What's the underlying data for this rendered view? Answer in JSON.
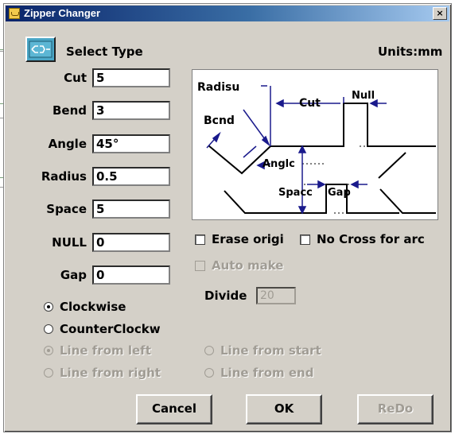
{
  "window": {
    "title": "Zipper Changer",
    "close_label": "×"
  },
  "header": {
    "select_type_label": "Select Type",
    "units_label": "Units:mm"
  },
  "params": [
    {
      "label": "Cut",
      "value": "5"
    },
    {
      "label": "Bend",
      "value": "3"
    },
    {
      "label": "Angle",
      "value": "45°"
    },
    {
      "label": "Radius",
      "value": "0.5"
    },
    {
      "label": "Space",
      "value": "5"
    },
    {
      "label": "NULL",
      "value": "0"
    },
    {
      "label": "Gap",
      "value": "0"
    }
  ],
  "diagram": {
    "labels": {
      "radius": "Radisu",
      "cut": "Cut",
      "null": "Null",
      "bend": "Bcnd",
      "angle": "Anglc",
      "space": "Spacc",
      "gap": "Gap"
    },
    "line_color": "#000000",
    "arrow_color": "#1a1a8c"
  },
  "options": {
    "erase_origi": {
      "label": "Erase origi",
      "checked": false
    },
    "no_cross": {
      "label": "No Cross for arc",
      "checked": false
    },
    "auto_make": {
      "label": "Auto make",
      "checked": false,
      "disabled": true
    },
    "divide_label": "Divide",
    "divide_value": "20"
  },
  "direction": {
    "clockwise": {
      "label": "Clockwise",
      "selected": true
    },
    "counterclockwise": {
      "label": "CounterClockw",
      "selected": false
    }
  },
  "line_from": {
    "left": {
      "label": "Line from left",
      "selected": true,
      "disabled": true
    },
    "right": {
      "label": "Line from right",
      "selected": false,
      "disabled": true
    },
    "start": {
      "label": "Line from start",
      "selected": false,
      "disabled": true
    },
    "end": {
      "label": "Line from end",
      "selected": false,
      "disabled": true
    }
  },
  "buttons": {
    "cancel": "Cancel",
    "ok": "OK",
    "redo": "ReDo"
  },
  "colors": {
    "face": "#d4d0c8",
    "title_start": "#0a246a",
    "title_end": "#a6caf0",
    "disabled_text": "#a09c94",
    "type_icon_bg": "#4aa6c6"
  }
}
